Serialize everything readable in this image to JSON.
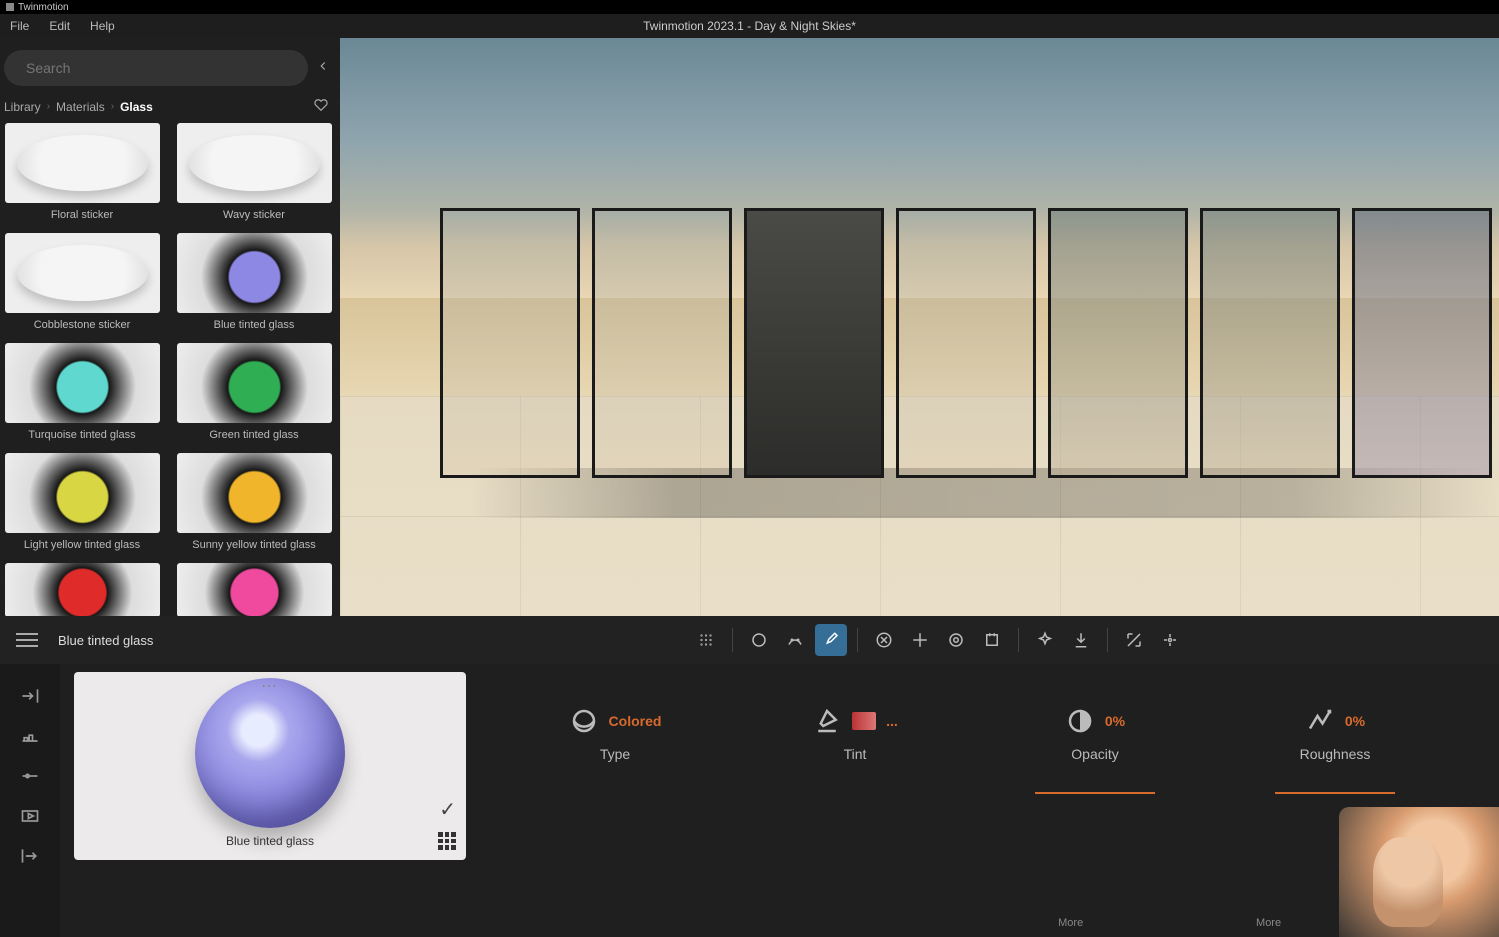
{
  "titlebar": {
    "app": "Twinmotion"
  },
  "menubar": {
    "items": [
      "File",
      "Edit",
      "Help"
    ],
    "doc_title": "Twinmotion 2023.1 - Day & Night Skies*"
  },
  "library": {
    "search_placeholder": "Search",
    "breadcrumb": {
      "root": "Library",
      "mid": "Materials",
      "current": "Glass"
    },
    "materials": [
      {
        "label": "Floral sticker",
        "ball": "#f2f2f2",
        "pattern": true
      },
      {
        "label": "Wavy sticker",
        "ball": "#f2f2f2",
        "pattern": true
      },
      {
        "label": "Cobblestone sticker",
        "ball": "#f2f2f2",
        "pattern": true
      },
      {
        "label": "Blue tinted glass",
        "ball": "#8d88e4"
      },
      {
        "label": "Turquoise tinted glass",
        "ball": "#5fd8d0"
      },
      {
        "label": "Green tinted glass",
        "ball": "#2fae53"
      },
      {
        "label": "Light yellow tinted glass",
        "ball": "#d8d642"
      },
      {
        "label": "Sunny yellow tinted glass",
        "ball": "#f0b52a"
      },
      {
        "label": "",
        "ball": "#e02b2b",
        "partial": true
      },
      {
        "label": "",
        "ball": "#ef4a9e",
        "partial": true
      }
    ]
  },
  "selection": {
    "name": "Blue tinted glass"
  },
  "toolbar": {
    "grid": "grid-icon",
    "circle": "circle-icon",
    "scatter": "scatter-icon",
    "picker": "picker-icon",
    "close": "close-icon",
    "move": "move-icon",
    "target": "target-icon",
    "frame": "frame-icon",
    "sparkle": "sparkle-icon",
    "download": "download-icon",
    "expand": "expand-icon",
    "snap": "snap-icon"
  },
  "dock": {
    "left_buttons": [
      "import-icon",
      "height-icon",
      "point-icon",
      "media-icon",
      "export-icon"
    ],
    "preview_label": "Blue tinted glass",
    "props": {
      "type": {
        "label": "Type",
        "value": "Colored"
      },
      "tint": {
        "label": "Tint",
        "value": "..."
      },
      "opacity": {
        "label": "Opacity",
        "value": "0%"
      },
      "roughness": {
        "label": "Roughness",
        "value": "0%"
      }
    },
    "more_label": "More"
  }
}
